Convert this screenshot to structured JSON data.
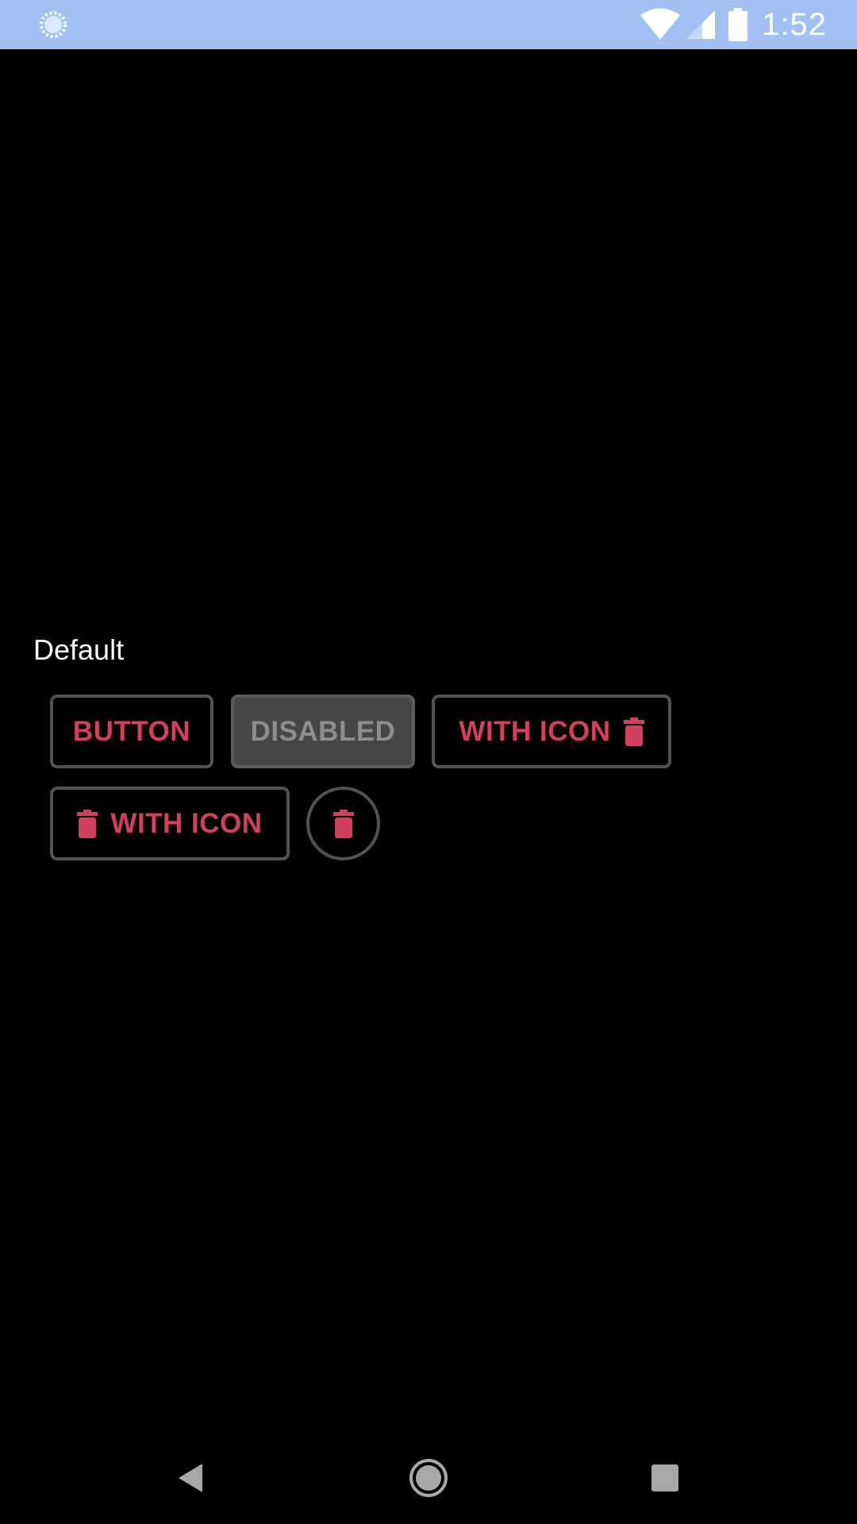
{
  "status_bar": {
    "time": "1:52",
    "icons": [
      "loading-circle-icon",
      "wifi-icon",
      "signal-icon",
      "battery-icon"
    ],
    "background": "#a1c1f3"
  },
  "content": {
    "section_label": "Default",
    "buttons": {
      "button": {
        "label": "BUTTON"
      },
      "disabled": {
        "label": "DISABLED"
      },
      "with_icon_trailing": {
        "label": "WITH ICON",
        "icon": "trash-icon"
      },
      "with_icon_leading": {
        "label": "WITH ICON",
        "icon": "trash-icon"
      },
      "icon_only": {
        "icon": "trash-icon"
      }
    }
  },
  "nav_bar": {
    "icons": [
      "back-icon",
      "home-icon",
      "recents-icon"
    ]
  },
  "colors": {
    "accent": "#d3405e",
    "outline": "#525252",
    "disabled_fill": "#464646",
    "disabled_text": "#8e8e8e",
    "background": "#000000"
  }
}
